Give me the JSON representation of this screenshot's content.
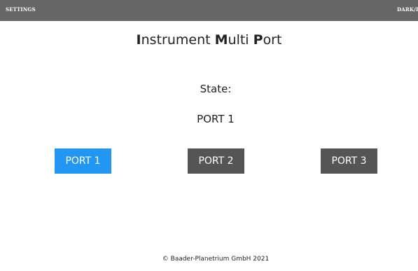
{
  "topbar": {
    "settings_label": "SETTINGS",
    "theme_label": "DARK/LIGHT"
  },
  "title": {
    "part1_initial": "I",
    "part1_rest": "nstrument ",
    "part2_initial": "M",
    "part2_rest": "ulti ",
    "part3_initial": "P",
    "part3_rest": "ort"
  },
  "state": {
    "label": "State:",
    "value": "PORT 1"
  },
  "ports": [
    {
      "label": "PORT 1",
      "active": true
    },
    {
      "label": "PORT 2",
      "active": false
    },
    {
      "label": "PORT 3",
      "active": false
    }
  ],
  "colors": {
    "topbar_bg": "#666666",
    "active_button": "#2196f3",
    "inactive_button": "#555555"
  },
  "footer": {
    "text": "© Baader-Planetrium GmbH 2021"
  }
}
